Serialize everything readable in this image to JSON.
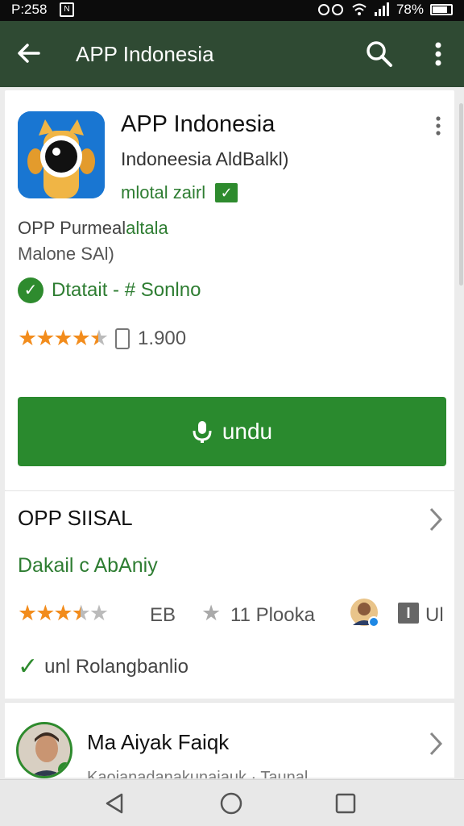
{
  "status_bar": {
    "time": "P:258",
    "notification_label": "N",
    "battery": "78%"
  },
  "app_bar": {
    "title": "APP Indonesia"
  },
  "app": {
    "name": "APP Indonesia",
    "developer": "Indoneesia AldBalkl)",
    "category": "mlotal zairl",
    "description_prefix": "OPP Purmeal",
    "description_highlight": "altala",
    "description_line2": "Malone SAl)",
    "detail_label": "Dtatait - # Sonlno",
    "rating_stars": 4.5,
    "review_count": "1.900"
  },
  "install_button": {
    "label": "undu",
    "color": "#2a8a2e"
  },
  "section": {
    "title": "OPP SIISAL",
    "subtitle": "Dakail c AbAniy",
    "rating_stars": 3.5,
    "rating_label": "EB",
    "downloads_label": "11 Plooka",
    "info_icon_label": "I",
    "ui_label": "Ul",
    "verified_label": "unl Rolangbanlio"
  },
  "review": {
    "name": "Ma Aiyak Faiqk",
    "subtitle": "Kaoianadanakunaiauk · Taunal"
  },
  "colors": {
    "app_bar": "#2f4a33",
    "accent_green": "#2e7d32",
    "star_orange": "#f28c1c"
  }
}
